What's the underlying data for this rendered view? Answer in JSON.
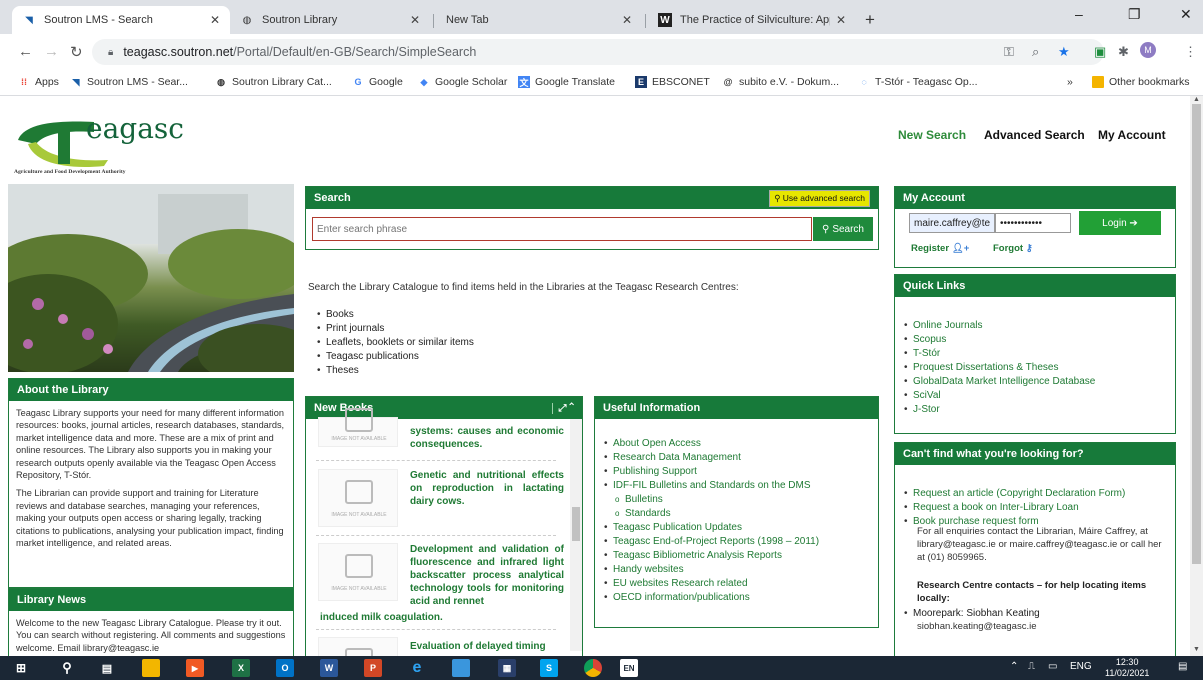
{
  "browser": {
    "tabs": [
      {
        "title": "Soutron LMS - Search",
        "icon": "soutron-icon",
        "active": true
      },
      {
        "title": "Soutron Library",
        "icon": "globe-icon",
        "active": false
      },
      {
        "title": "New Tab",
        "icon": "",
        "active": false
      },
      {
        "title": "The Practice of Silviculture: Appli",
        "icon": "w-icon",
        "active": false
      }
    ],
    "new_tab": "+",
    "window_controls": {
      "minimize": "–",
      "maximize": "❐",
      "close": "✕"
    },
    "url": {
      "host": "teagasc.soutron.net",
      "path": "/Portal/Default/en-GB/Search/SimpleSearch"
    },
    "profile_initial": "M",
    "bookmarks": [
      {
        "label": "Apps",
        "icon": "apps-icon"
      },
      {
        "label": "Soutron LMS - Sear...",
        "icon": "soutron-icon"
      },
      {
        "label": "Soutron Library Cat...",
        "icon": "globe-icon"
      },
      {
        "label": "Google",
        "icon": "google-icon"
      },
      {
        "label": "Google Scholar",
        "icon": "scholar-icon"
      },
      {
        "label": "Google Translate",
        "icon": "translate-icon"
      },
      {
        "label": "EBSCONET",
        "icon": "ebsco-icon"
      },
      {
        "label": "subito e.V. - Dokum...",
        "icon": "subito-icon"
      },
      {
        "label": "T-Stór - Teagasc Op...",
        "icon": "tstor-icon"
      }
    ],
    "bookmarks_more": "»",
    "other_bookmarks": "Other bookmarks"
  },
  "site": {
    "logo_text": "eagasc",
    "logo_sub": "Agriculture and Food Development Authority",
    "nav": {
      "new_search": "New Search",
      "advanced_search": "Advanced Search",
      "my_account": "My Account"
    }
  },
  "search": {
    "header": "Search",
    "advanced_label": "Use advanced search",
    "placeholder": "Enter search phrase",
    "button": "Search",
    "intro": "Search the Library Catalogue to find items held in the Libraries at the Teagasc Research Centres:",
    "items": [
      "Books",
      "Print journals",
      "Leaflets, booklets or similar items",
      "Teagasc publications",
      "Theses"
    ]
  },
  "about": {
    "header": "About the Library",
    "p1": "Teagasc Library supports your need for many different information resources: books, journal articles, research databases, standards, market intelligence data and more. These are a mix of print and online resources. The Library also supports you in making your research outputs openly available via the Teagasc Open Access Repository, T-Stór.",
    "p2": "The Librarian can provide support and training for Literature reviews and database searches, managing your references, making your outputs open access or sharing legally, tracking citations to publications, analysing your publication impact, finding market intelligence, and related areas."
  },
  "news": {
    "header": "Library News",
    "text": "Welcome to the new Teagasc Library Catalogue. Please try it out. You can search without registering. All comments and suggestions welcome. Email library@teagasc.ie"
  },
  "new_books": {
    "header": "New Books",
    "no_image": "IMAGE NOT AVAILABLE",
    "items": [
      {
        "title": "systems: causes and economic consequences."
      },
      {
        "title": "Genetic and nutritional effects on reproduction in lactating dairy cows."
      },
      {
        "title": "Development and validation of fluorescence and infrared light backscatter process analytical technology tools for monitoring acid and rennet",
        "tail": "induced milk coagulation."
      },
      {
        "title": "Evaluation of delayed timing"
      }
    ]
  },
  "useful": {
    "header": "Useful Information",
    "items": [
      {
        "label": "About Open Access",
        "sub": false
      },
      {
        "label": "Research Data Management",
        "sub": false
      },
      {
        "label": "Publishing Support",
        "sub": false
      },
      {
        "label": "IDF-FIL Bulletins and Standards on the DMS",
        "sub": false
      },
      {
        "label": "Bulletins",
        "sub": true
      },
      {
        "label": "Standards",
        "sub": true
      },
      {
        "label": "Teagasc Publication Updates",
        "sub": false
      },
      {
        "label": "Teagasc End-of-Project Reports (1998 – 2011)",
        "sub": false
      },
      {
        "label": "Teagasc Bibliometric Analysis Reports",
        "sub": false
      },
      {
        "label": "Handy websites",
        "sub": false
      },
      {
        "label": "EU websites Research related",
        "sub": false
      },
      {
        "label": "OECD information/publications",
        "sub": false
      }
    ]
  },
  "account": {
    "header": "My Account",
    "username": "maire.caffrey@te",
    "password": "••••••••••••",
    "login": "Login",
    "register": "Register",
    "forgot": "Forgot"
  },
  "quick_links": {
    "header": "Quick Links",
    "items": [
      "Online Journals",
      "Scopus",
      "T-Stór",
      "Proquest Dissertations & Theses",
      "GlobalData Market Intelligence Database",
      "SciVal",
      "J-Stor"
    ]
  },
  "cant_find": {
    "header": "Can't find what you're looking for?",
    "items": [
      "Request an article (Copyright Declaration Form)",
      "Request a book on Inter-Library Loan",
      "Book purchase request form"
    ],
    "enquiry_text": "For all enquiries contact the Librarian, Máire Caffrey, at library@teagasc.ie or maire.caffrey@teagasc.ie or call her at (01) 8059965.",
    "rc_heading": "Research Centre contacts – for help locating items locally:",
    "rc_items": [
      "Moorepark: Siobhan Keating"
    ],
    "rc_email": "siobhan.keating@teagasc.ie"
  },
  "taskbar": {
    "lang_badge": "EN",
    "lang": "ENG",
    "time": "12:30",
    "date": "11/02/2021"
  }
}
